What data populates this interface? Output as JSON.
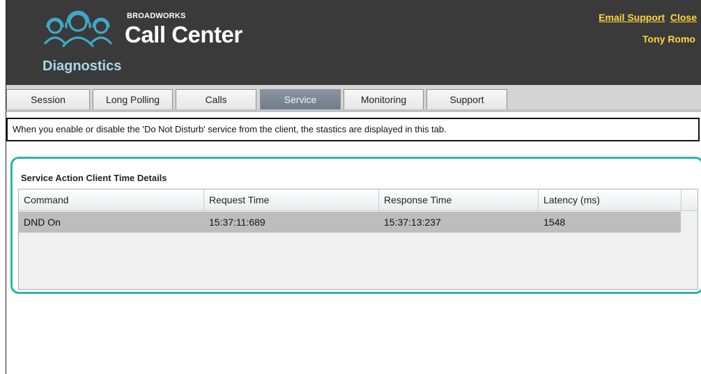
{
  "header": {
    "brand_small": "BROADWORKS",
    "brand_big": "Call Center",
    "subtitle": "Diagnostics",
    "links": {
      "email_support": "Email Support",
      "close": "Close"
    },
    "user_name": "Tony Romo",
    "logo_icon": "agents-headset-icon",
    "colors": {
      "header_bg": "#3a3a3a",
      "link": "#ffd640",
      "subtitle": "#a9d8e8",
      "logo": "#3fa9c7"
    }
  },
  "tabs": [
    {
      "label": "Session",
      "active": false
    },
    {
      "label": "Long Polling",
      "active": false
    },
    {
      "label": "Calls",
      "active": false
    },
    {
      "label": "Service",
      "active": true
    },
    {
      "label": "Monitoring",
      "active": false
    },
    {
      "label": "Support",
      "active": false
    }
  ],
  "info_text": "When you enable or disable the 'Do Not Disturb' service from the client, the stastics are displayed in this tab.",
  "panel": {
    "title": "Service Action Client Time Details",
    "columns": [
      "Command",
      "Request Time",
      "Response Time",
      "Latency (ms)"
    ],
    "rows": [
      [
        "DND On",
        "15:37:11:689",
        "15:37:13:237",
        "1548"
      ]
    ],
    "border_color": "#2bb4aa"
  }
}
